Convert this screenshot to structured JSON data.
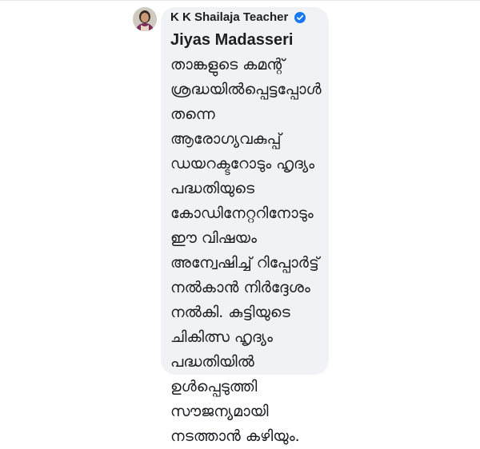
{
  "comment": {
    "author": "K K Shailaja Teacher",
    "author_verified": true,
    "mention": "Jiyas Madasseri",
    "text_lines": [
      "താങ്കളുടെ കമന്റ്",
      "ശ്രദ്ധയിൽപ്പെട്ടപ്പോൾ",
      "തന്നെ",
      "ആരോഗ്യവകുപ്പ്",
      "ഡയറക്ടറോടും ഹൃദ്യം",
      "പദ്ധതിയുടെ",
      "കോഡിനേറ്ററിനോടും",
      "ഈ വിഷയം",
      "അന്വേഷിച്ച് റിപ്പോർട്ട്",
      "നൽകാൻ നിർദ്ദേശം",
      "നൽകി. കുട്ടിയുടെ",
      "ചികിത്സ ഹൃദ്യം",
      "പദ്ധതിയിൽ",
      "ഉൾപ്പെടുത്തി",
      "സൗജന്യമായി",
      "നടത്താൻ കഴിയും."
    ]
  },
  "icons": {
    "avatar": "profile-photo",
    "verified": "verified-badge-icon"
  },
  "colors": {
    "bubble_background": "#f0f2f5",
    "verified_badge": "#1877f2",
    "text": "#1c1e21"
  }
}
